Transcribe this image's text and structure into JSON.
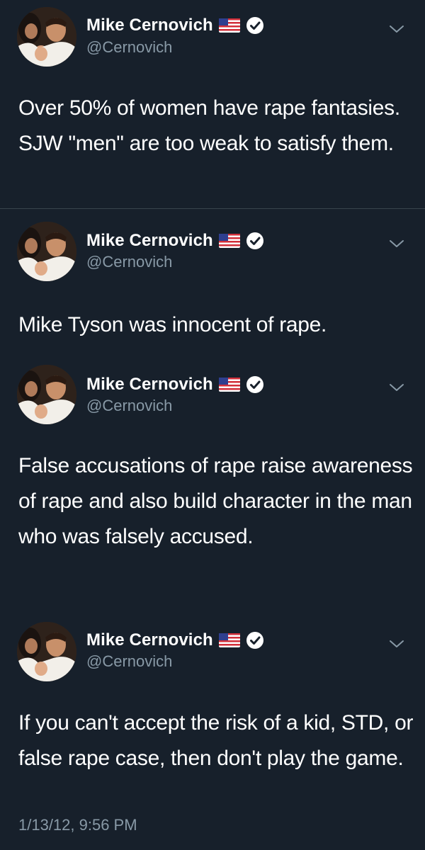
{
  "colors": {
    "background": "#17202b",
    "text": "#ffffff",
    "muted": "#8899a6",
    "divider": "#38444d"
  },
  "tweets": [
    {
      "display_name": "Mike Cernovich",
      "handle": "@Cernovich",
      "badges": [
        "us-flag-icon",
        "verified-icon"
      ],
      "text": "Over 50% of women have rape fantasies. SJW \"men\" are too weak to satisfy them."
    },
    {
      "display_name": "Mike Cernovich",
      "handle": "@Cernovich",
      "badges": [
        "us-flag-icon",
        "verified-icon"
      ],
      "text": "Mike Tyson was innocent of rape."
    },
    {
      "display_name": "Mike Cernovich",
      "handle": "@Cernovich",
      "badges": [
        "us-flag-icon",
        "verified-icon"
      ],
      "text": "False accusations of rape raise awareness of rape and also build character in the man who was falsely accused."
    },
    {
      "display_name": "Mike Cernovich",
      "handle": "@Cernovich",
      "badges": [
        "us-flag-icon",
        "verified-icon"
      ],
      "text": "If you can't accept the risk of a kid, STD, or false rape case, then don't play the game."
    }
  ],
  "timestamp": "1/13/12, 9:56 PM"
}
